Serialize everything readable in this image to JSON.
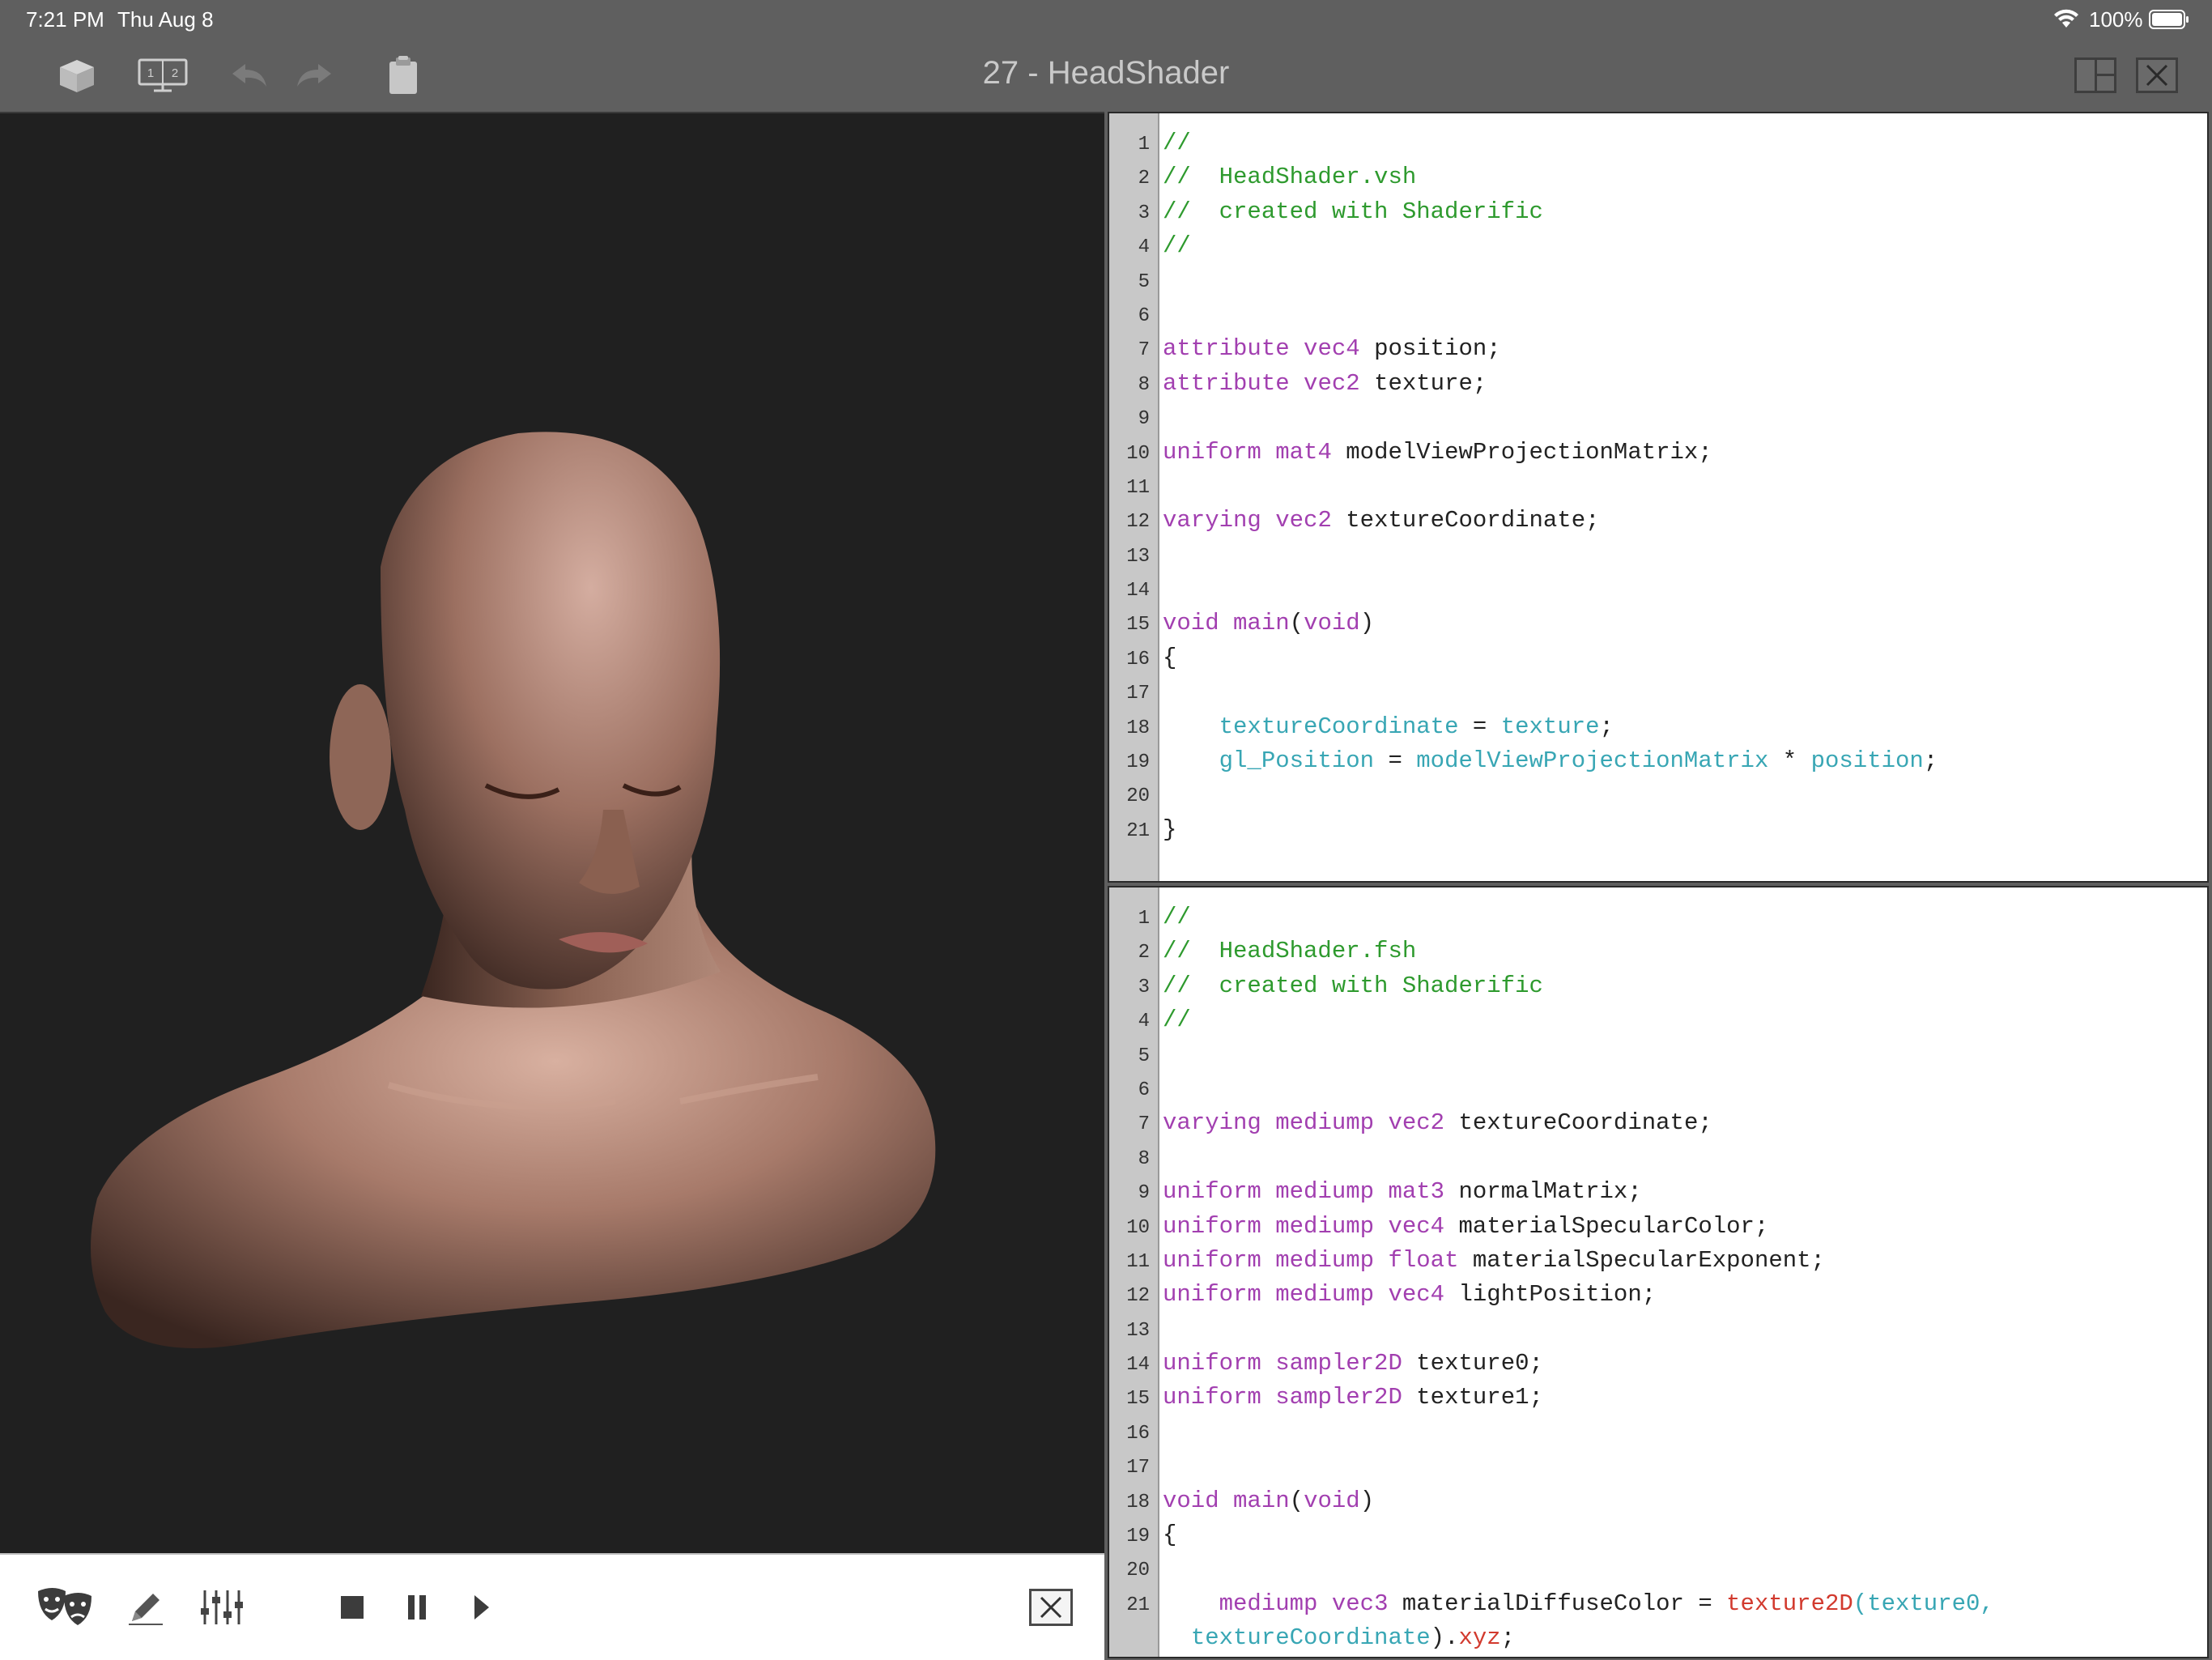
{
  "status_bar": {
    "time": "7:21 PM",
    "date": "Thu Aug 8",
    "battery": "100%",
    "icons": [
      "wifi-icon",
      "battery-icon"
    ]
  },
  "toolbar": {
    "title": "27 - HeadShader",
    "buttons": [
      "cube-icon",
      "two-displays-icon",
      "undo-icon",
      "redo-icon",
      "clipboard-icon",
      "layout-icon",
      "close-icon"
    ],
    "display_label_1": "1",
    "display_label_2": "2"
  },
  "viewport": {
    "subject": "3D rendered bald male head bust"
  },
  "playback": {
    "buttons": [
      "theater-masks-icon",
      "pencil-icon",
      "sliders-icon",
      "stop-icon",
      "pause-icon",
      "play-icon",
      "close-icon"
    ]
  },
  "colors": {
    "comment": "#2e9a2e",
    "keyword": "#a23fb0",
    "builtin": "#38a6b4",
    "function": "#d23a2e",
    "toolbar_bg": "#5f5f5f",
    "viewport_bg": "#202020"
  },
  "vertex_shader": {
    "lines": [
      [
        [
          "c",
          "//"
        ]
      ],
      [
        [
          "c",
          "//  HeadShader.vsh"
        ]
      ],
      [
        [
          "c",
          "//  created with Shaderific"
        ]
      ],
      [
        [
          "c",
          "//"
        ]
      ],
      [],
      [],
      [
        [
          "k",
          "attribute"
        ],
        [
          "p",
          " "
        ],
        [
          "k",
          "vec4"
        ],
        [
          "p",
          " position;"
        ]
      ],
      [
        [
          "k",
          "attribute"
        ],
        [
          "p",
          " "
        ],
        [
          "k",
          "vec2"
        ],
        [
          "p",
          " texture;"
        ]
      ],
      [],
      [
        [
          "k",
          "uniform"
        ],
        [
          "p",
          " "
        ],
        [
          "k",
          "mat4"
        ],
        [
          "p",
          " modelViewProjectionMatrix;"
        ]
      ],
      [],
      [
        [
          "k",
          "varying"
        ],
        [
          "p",
          " "
        ],
        [
          "k",
          "vec2"
        ],
        [
          "p",
          " textureCoordinate;"
        ]
      ],
      [],
      [],
      [
        [
          "k",
          "void"
        ],
        [
          "p",
          " "
        ],
        [
          "k",
          "main"
        ],
        [
          "p",
          "("
        ],
        [
          "k",
          "void"
        ],
        [
          "p",
          ")"
        ]
      ],
      [
        [
          "p",
          "{"
        ]
      ],
      [],
      [
        [
          "p",
          "    "
        ],
        [
          "v",
          "textureCoordinate"
        ],
        [
          "p",
          " = "
        ],
        [
          "v",
          "texture"
        ],
        [
          "p",
          ";"
        ]
      ],
      [
        [
          "p",
          "    "
        ],
        [
          "v",
          "gl_Position"
        ],
        [
          "p",
          " = "
        ],
        [
          "v",
          "modelViewProjectionMatrix"
        ],
        [
          "p",
          " * "
        ],
        [
          "v",
          "position"
        ],
        [
          "p",
          ";"
        ]
      ],
      [],
      [
        [
          "p",
          "}"
        ]
      ]
    ]
  },
  "fragment_shader": {
    "lines": [
      [
        [
          "c",
          "//"
        ]
      ],
      [
        [
          "c",
          "//  HeadShader.fsh"
        ]
      ],
      [
        [
          "c",
          "//  created with Shaderific"
        ]
      ],
      [
        [
          "c",
          "//"
        ]
      ],
      [],
      [],
      [
        [
          "k",
          "varying"
        ],
        [
          "p",
          " "
        ],
        [
          "k",
          "mediump"
        ],
        [
          "p",
          " "
        ],
        [
          "k",
          "vec2"
        ],
        [
          "p",
          " textureCoordinate;"
        ]
      ],
      [],
      [
        [
          "k",
          "uniform"
        ],
        [
          "p",
          " "
        ],
        [
          "k",
          "mediump"
        ],
        [
          "p",
          " "
        ],
        [
          "k",
          "mat3"
        ],
        [
          "p",
          " normalMatrix;"
        ]
      ],
      [
        [
          "k",
          "uniform"
        ],
        [
          "p",
          " "
        ],
        [
          "k",
          "mediump"
        ],
        [
          "p",
          " "
        ],
        [
          "k",
          "vec4"
        ],
        [
          "p",
          " materialSpecularColor;"
        ]
      ],
      [
        [
          "k",
          "uniform"
        ],
        [
          "p",
          " "
        ],
        [
          "k",
          "mediump"
        ],
        [
          "p",
          " "
        ],
        [
          "k",
          "float"
        ],
        [
          "p",
          " materialSpecularExponent;"
        ]
      ],
      [
        [
          "k",
          "uniform"
        ],
        [
          "p",
          " "
        ],
        [
          "k",
          "mediump"
        ],
        [
          "p",
          " "
        ],
        [
          "k",
          "vec4"
        ],
        [
          "p",
          " lightPosition;"
        ]
      ],
      [],
      [
        [
          "k",
          "uniform"
        ],
        [
          "p",
          " "
        ],
        [
          "k",
          "sampler2D"
        ],
        [
          "p",
          " texture0;"
        ]
      ],
      [
        [
          "k",
          "uniform"
        ],
        [
          "p",
          " "
        ],
        [
          "k",
          "sampler2D"
        ],
        [
          "p",
          " texture1;"
        ]
      ],
      [],
      [],
      [
        [
          "k",
          "void"
        ],
        [
          "p",
          " "
        ],
        [
          "k",
          "main"
        ],
        [
          "p",
          "("
        ],
        [
          "k",
          "void"
        ],
        [
          "p",
          ")"
        ]
      ],
      [
        [
          "p",
          "{"
        ]
      ],
      [],
      [
        [
          "p",
          "    "
        ],
        [
          "k",
          "mediump"
        ],
        [
          "p",
          " "
        ],
        [
          "k",
          "vec3"
        ],
        [
          "p",
          " materialDiffuseColor = "
        ],
        [
          "f",
          "texture2D"
        ],
        [
          "v",
          "(texture0,"
        ]
      ]
    ],
    "continuation": [
      [
        "p",
        "  "
      ],
      [
        "v",
        "textureCoordinate"
      ],
      [
        "p",
        ")."
      ],
      [
        "f",
        "xyz"
      ],
      [
        "p",
        ";"
      ]
    ]
  }
}
